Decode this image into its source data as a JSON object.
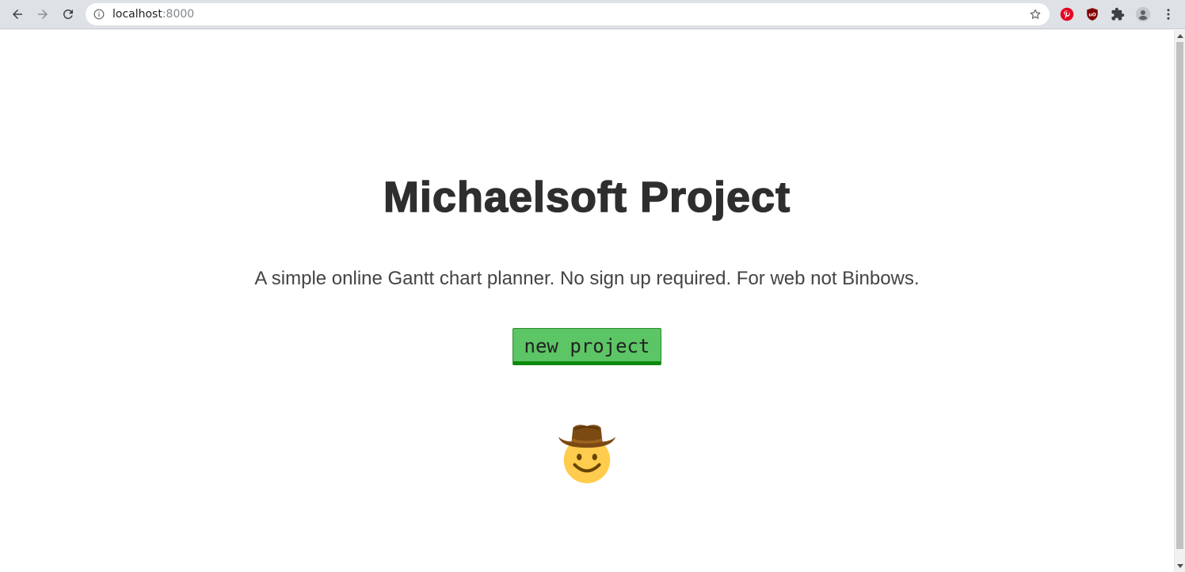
{
  "browser": {
    "url_host": "localhost",
    "url_port": ":8000",
    "icons": {
      "back": "arrow-left-icon",
      "forward": "arrow-right-icon",
      "reload": "reload-icon",
      "info": "info-icon",
      "bookmark": "star-icon",
      "pinterest": "pinterest-icon",
      "ublock": "ublock-icon",
      "extensions": "puzzle-icon",
      "profile": "profile-icon",
      "menu": "kebab-menu-icon"
    }
  },
  "page": {
    "title": "Michaelsoft Project",
    "tagline": "A simple online Gantt chart planner. No sign up required. For web not Binbows.",
    "new_project_label": "new project",
    "mascot": "cowboy-face-icon"
  },
  "colors": {
    "button_bg": "#5cc565",
    "button_border": "#0e8a0e",
    "title": "#2e2e2e",
    "tagline": "#444444"
  }
}
